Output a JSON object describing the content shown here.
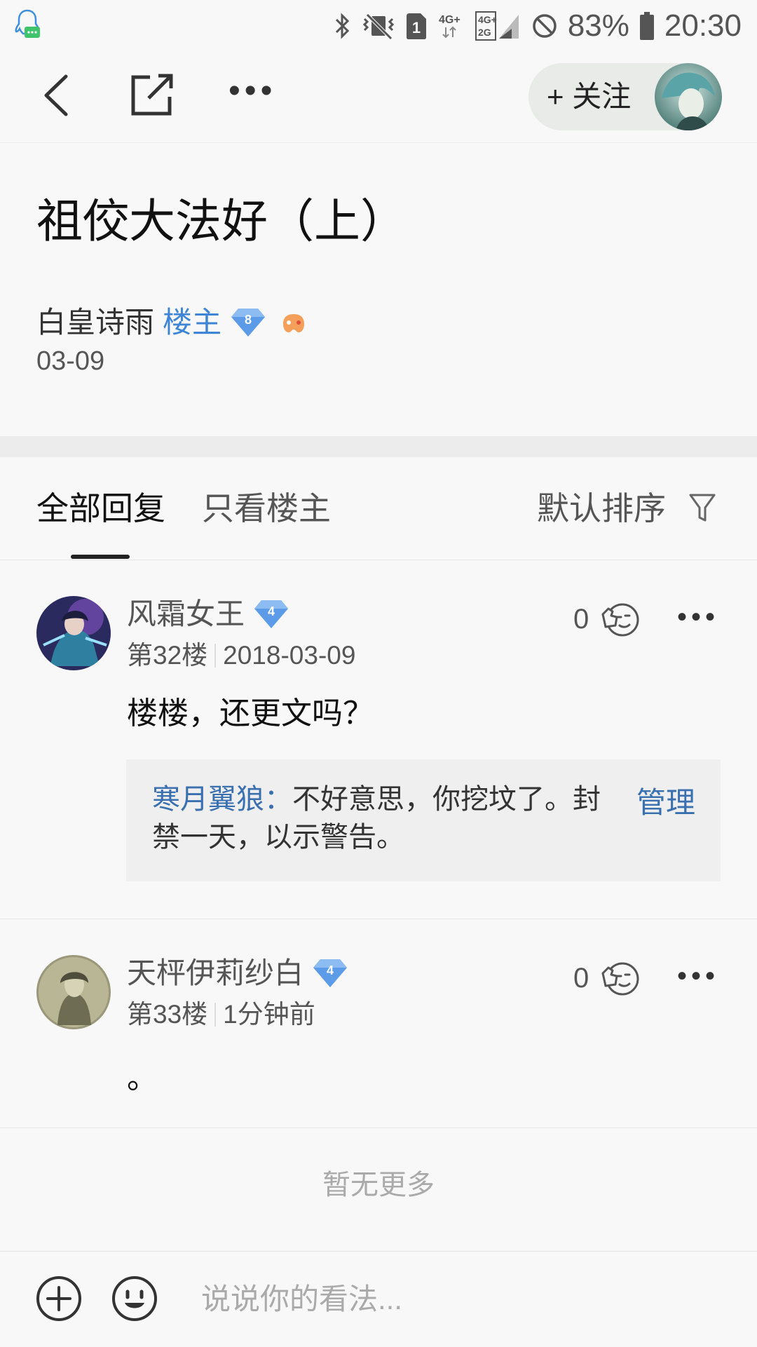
{
  "status_bar": {
    "network1": "4G+",
    "network2": "4G+ 2G",
    "battery": "83%",
    "time": "20:30"
  },
  "nav": {
    "follow_label": "+ 关注"
  },
  "post": {
    "title": "祖佼大法好（上）",
    "author": "白皇诗雨",
    "op_tag": "楼主",
    "level": "8",
    "date": "03-09"
  },
  "tabs": {
    "all": "全部回复",
    "op_only": "只看楼主",
    "sort": "默认排序"
  },
  "replies": [
    {
      "name": "风霜女王",
      "level": "4",
      "floor": "第32楼",
      "time": "2018-03-09",
      "likes": "0",
      "text": "楼楼，还更文吗？",
      "sub_reply": {
        "user": "寒月翼狼：",
        "text": "不好意思，你挖坟了。封禁一天，以示警告。",
        "manage": "管理"
      }
    },
    {
      "name": "天枰伊莉纱白",
      "level": "4",
      "floor": "第33楼",
      "time": "1分钟前",
      "likes": "0",
      "text": "。"
    }
  ],
  "footer": {
    "no_more": "暂无更多",
    "input_placeholder": "说说你的看法..."
  },
  "colors": {
    "accent_blue": "#3e85d6",
    "manage_blue": "#3a6fb0",
    "badge_blue": "#5b9be8"
  }
}
